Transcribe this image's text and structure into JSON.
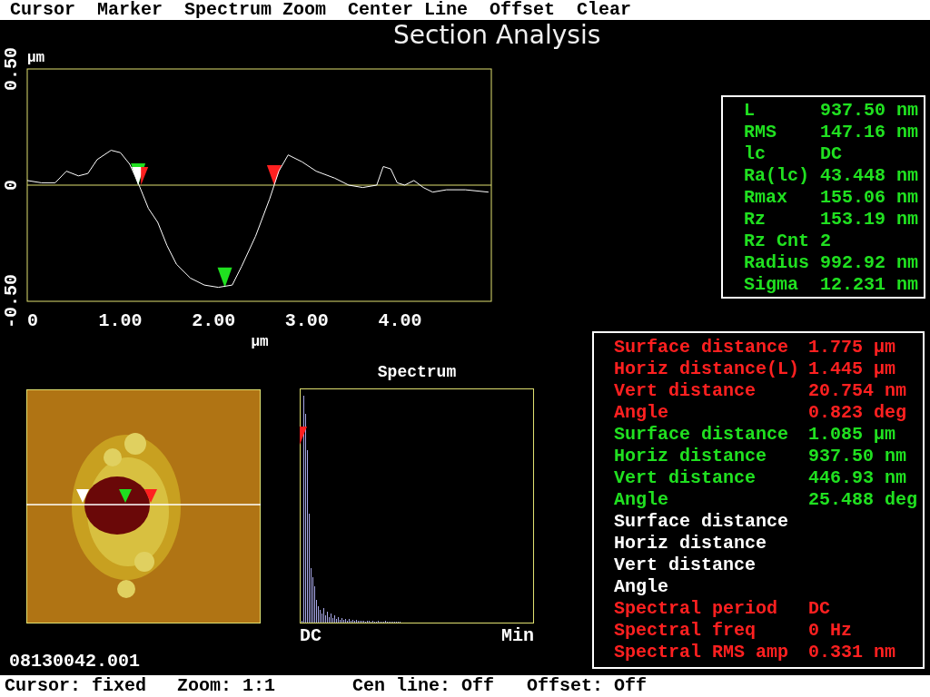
{
  "menu": [
    {
      "label": "Cursor"
    },
    {
      "label": "Marker"
    },
    {
      "label": "Spectrum Zoom"
    },
    {
      "label": "Center Line"
    },
    {
      "label": "Offset"
    },
    {
      "label": "Clear"
    }
  ],
  "title": "Section Analysis",
  "profile": {
    "chart_data": {
      "type": "line",
      "xlabel": "µm",
      "ylabel": "µm",
      "xlim": [
        0,
        4.98
      ],
      "ylim": [
        -0.5,
        0.5
      ],
      "xticks": [
        {
          "value": 0,
          "label": "0"
        },
        {
          "value": 1,
          "label": "1.00"
        },
        {
          "value": 2,
          "label": "2.00"
        },
        {
          "value": 3,
          "label": "3.00"
        },
        {
          "value": 4,
          "label": "4.00"
        }
      ],
      "yticks": [
        {
          "value": 0.5,
          "label": "0.50"
        },
        {
          "value": 0,
          "label": "0"
        },
        {
          "value": -0.5,
          "label": "-0.50"
        }
      ],
      "x": [
        0,
        0.15,
        0.3,
        0.42,
        0.55,
        0.65,
        0.75,
        0.9,
        1.0,
        1.1,
        1.2,
        1.3,
        1.4,
        1.5,
        1.6,
        1.75,
        1.9,
        2.05,
        2.2,
        2.3,
        2.45,
        2.6,
        2.7,
        2.8,
        2.95,
        3.1,
        3.3,
        3.45,
        3.6,
        3.75,
        3.82,
        3.9,
        3.97,
        4.05,
        4.15,
        4.25,
        4.35,
        4.5,
        4.7,
        4.95
      ],
      "ref_lines": [
        {
          "axis": "y",
          "value": 0
        }
      ],
      "series": [
        {
          "color": "#ffffff",
          "values": [
            0.02,
            0.01,
            0.01,
            0.06,
            0.04,
            0.05,
            0.11,
            0.15,
            0.14,
            0.09,
            0.0,
            -0.1,
            -0.16,
            -0.26,
            -0.34,
            -0.4,
            -0.43,
            -0.44,
            -0.43,
            -0.35,
            -0.22,
            -0.06,
            0.06,
            0.13,
            0.1,
            0.06,
            0.03,
            0.0,
            -0.01,
            0.0,
            0.08,
            0.07,
            0.01,
            0.0,
            0.02,
            -0.01,
            -0.03,
            -0.02,
            -0.02,
            -0.03
          ]
        }
      ]
    }
  },
  "spectrum": {
    "title": "Spectrum",
    "left_label": "DC",
    "right_label": "Min"
  },
  "filename": "08130042.001",
  "stats": [
    {
      "label": "L",
      "value": "937.50 nm"
    },
    {
      "label": "RMS",
      "value": "147.16 nm"
    },
    {
      "label": "lc",
      "value": "DC"
    },
    {
      "label": "Ra(lc)",
      "value": "43.448 nm"
    },
    {
      "label": "Rmax",
      "value": "155.06 nm"
    },
    {
      "label": "Rz",
      "value": "153.19 nm"
    },
    {
      "label": "Rz Cnt",
      "value": "2"
    },
    {
      "label": "Radius",
      "value": "992.92 nm"
    },
    {
      "label": "Sigma",
      "value": "12.231 nm"
    }
  ],
  "measurements": [
    {
      "label": "Surface distance",
      "value": "1.775 µm",
      "color": "#ff2020"
    },
    {
      "label": "Horiz distance(L)",
      "value": "1.445 µm",
      "color": "#ff2020"
    },
    {
      "label": "Vert distance",
      "value": "20.754 nm",
      "color": "#ff2020"
    },
    {
      "label": "Angle",
      "value": "0.823 deg",
      "color": "#ff2020"
    },
    {
      "label": "Surface distance",
      "value": "1.085 µm",
      "color": "#20e020"
    },
    {
      "label": "Horiz distance",
      "value": "937.50 nm",
      "color": "#20e020"
    },
    {
      "label": "Vert distance",
      "value": "446.93 nm",
      "color": "#20e020"
    },
    {
      "label": "Angle",
      "value": "25.488 deg",
      "color": "#20e020"
    },
    {
      "label": "Surface distance",
      "color": "#ffffff"
    },
    {
      "label": "Horiz distance",
      "color": "#ffffff"
    },
    {
      "label": "Vert distance",
      "color": "#ffffff"
    },
    {
      "label": "Angle",
      "color": "#ffffff"
    },
    {
      "label": "Spectral period",
      "value": "DC",
      "color": "#ff2020"
    },
    {
      "label": "Spectral freq",
      "value": "0 Hz",
      "color": "#ff2020"
    },
    {
      "label": "Spectral RMS amp",
      "value": "0.331 nm",
      "color": "#ff2020"
    }
  ],
  "status_bar": [
    {
      "text": "Cursor: fixed"
    },
    {
      "text": "Zoom: 1:1"
    },
    {
      "text": "Cen line: Off"
    },
    {
      "text": "Offset: Off"
    }
  ]
}
